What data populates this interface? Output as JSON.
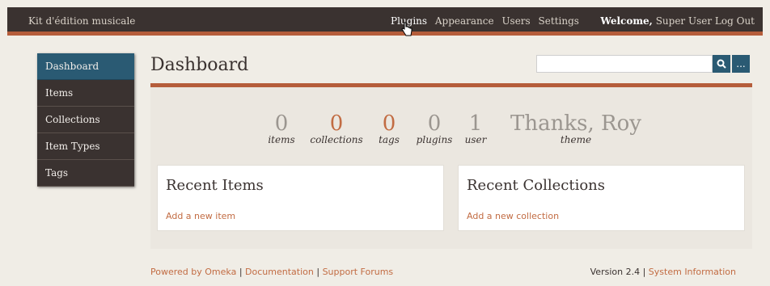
{
  "header": {
    "site_title": "Kit d'édition musicale",
    "nav": [
      {
        "label": "Plugins"
      },
      {
        "label": "Appearance"
      },
      {
        "label": "Users"
      },
      {
        "label": "Settings"
      }
    ],
    "welcome_label": "Welcome,",
    "user_name": "Super User",
    "logout_label": "Log Out"
  },
  "sidebar": {
    "items": [
      {
        "label": "Dashboard"
      },
      {
        "label": "Items"
      },
      {
        "label": "Collections"
      },
      {
        "label": "Item Types"
      },
      {
        "label": "Tags"
      }
    ]
  },
  "main": {
    "title": "Dashboard",
    "search": {
      "value": "",
      "search_icon": "search-icon",
      "options_label": "..."
    }
  },
  "stats": [
    {
      "value": "0",
      "label": "items"
    },
    {
      "value": "0",
      "label": "collections"
    },
    {
      "value": "0",
      "label": "tags"
    },
    {
      "value": "0",
      "label": "plugins"
    },
    {
      "value": "1",
      "label": "user"
    },
    {
      "value": "Thanks, Roy",
      "label": "theme"
    }
  ],
  "cards": {
    "recent_items": {
      "title": "Recent Items",
      "link": "Add a new item"
    },
    "recent_collections": {
      "title": "Recent Collections",
      "link": "Add a new collection"
    }
  },
  "footer": {
    "powered_by": "Powered by Omeka",
    "documentation": "Documentation",
    "support_forums": "Support Forums",
    "version": "Version 2.4",
    "system_information": "System Information"
  },
  "colors": {
    "accent": "#b55d3b",
    "nav_dark": "#3a3230",
    "active_blue": "#2a5a73"
  }
}
